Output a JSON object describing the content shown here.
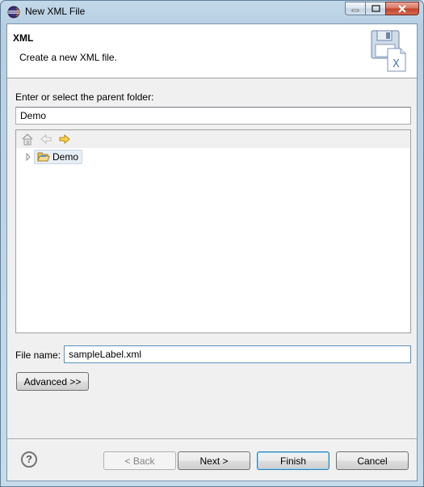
{
  "window": {
    "title": "New XML File",
    "icon": "eclipse-icon"
  },
  "header": {
    "title": "XML",
    "description": "Create a new XML file.",
    "image": "xml-file-wizard-image"
  },
  "parent_folder": {
    "label": "Enter or select the parent folder:",
    "value": "Demo"
  },
  "tree": {
    "toolbar": [
      "home-icon",
      "back-arrow-icon",
      "forward-arrow-icon"
    ],
    "nodes": [
      {
        "label": "Demo",
        "icon": "open-folder-icon",
        "expanded": false,
        "selected": true
      }
    ]
  },
  "file_name": {
    "label": "File name:",
    "value": "sampleLabel.xml"
  },
  "buttons": {
    "advanced": "Advanced >>",
    "back": "< Back",
    "next": "Next >",
    "finish": "Finish",
    "cancel": "Cancel",
    "help": "?"
  }
}
